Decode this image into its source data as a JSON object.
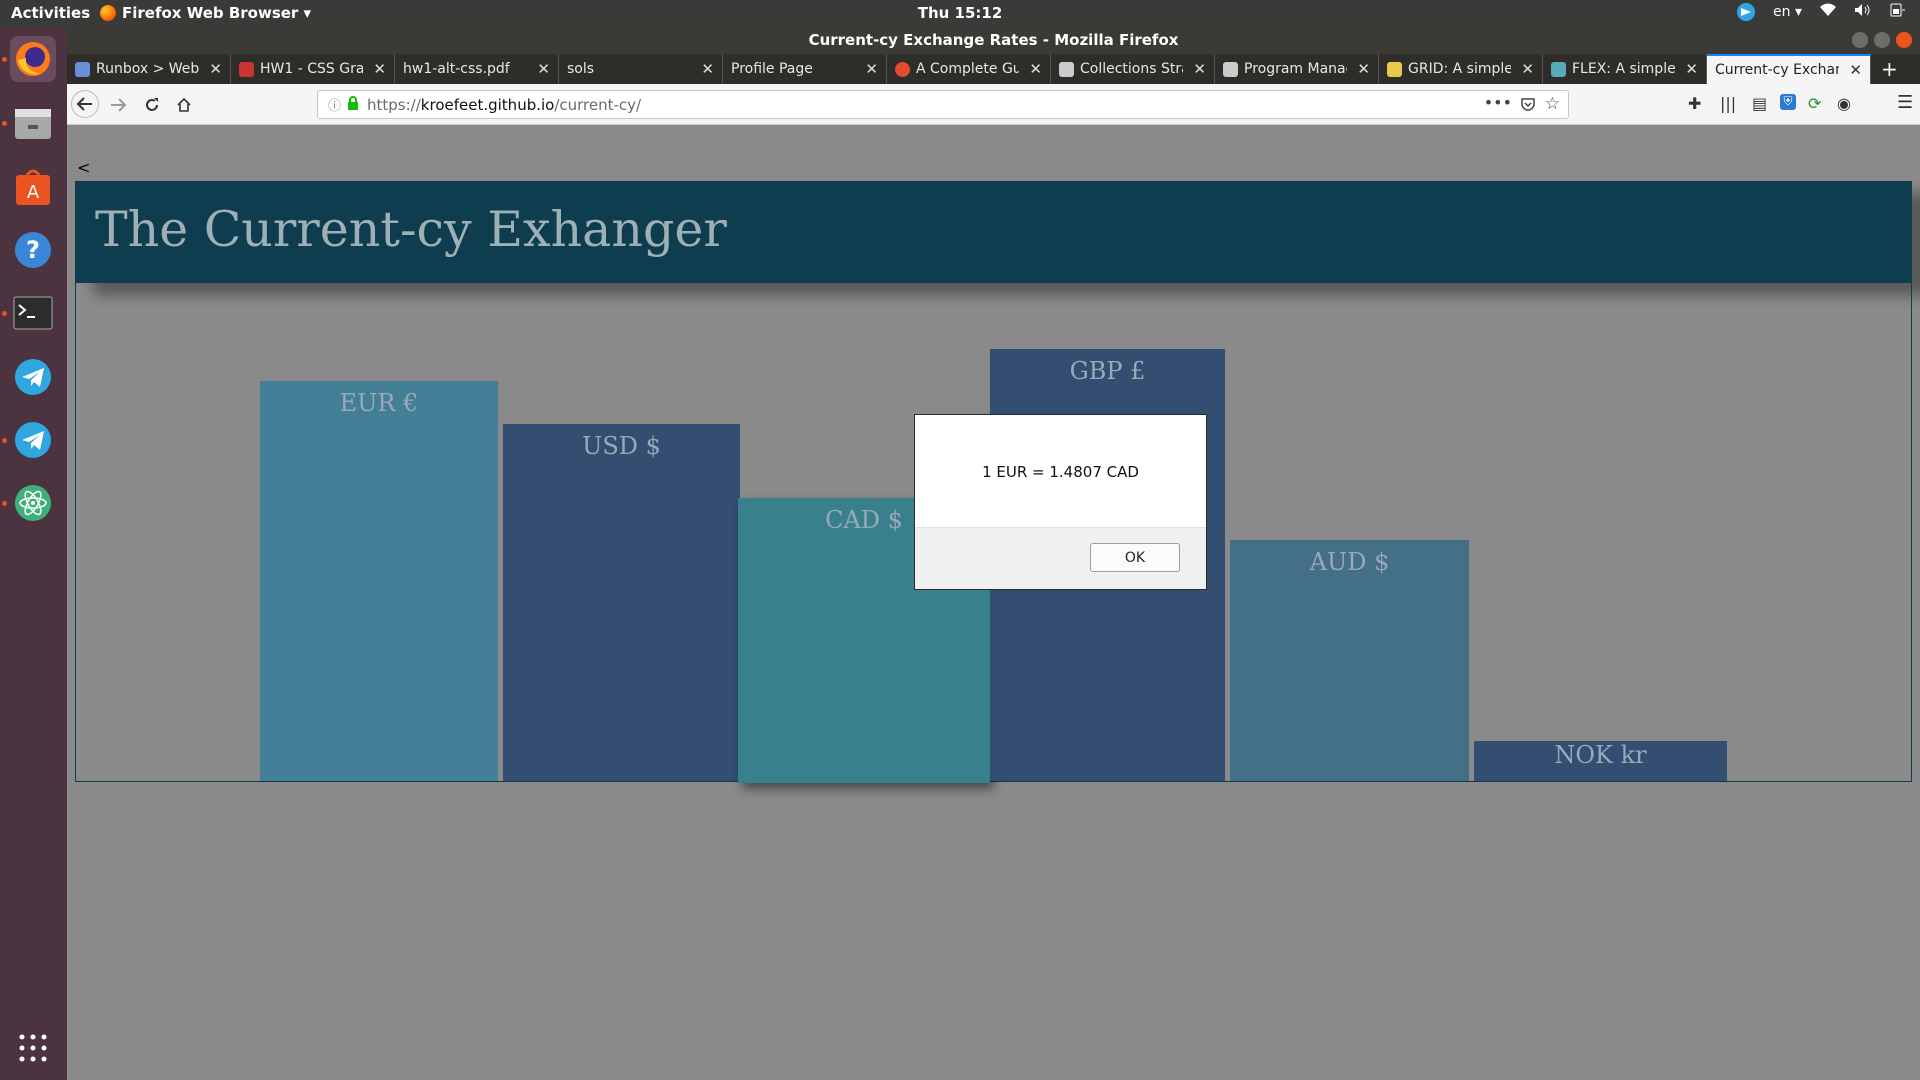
{
  "topbar": {
    "activities": "Activities",
    "app_name": "Firefox Web Browser ▾",
    "clock": "Thu 15:12",
    "lang": "en ▾"
  },
  "window": {
    "title": "Current-cy Exchange Rates - Mozilla Firefox"
  },
  "tabs": [
    {
      "label": "Runbox > Webmail",
      "icon_color": "#6a8fd8"
    },
    {
      "label": "HW1 - CSS Graphing",
      "icon_color": "#c33"
    },
    {
      "label": "hw1-alt-css.pdf",
      "icon_color": "#2e2d2a"
    },
    {
      "label": "sols",
      "icon_color": "#2e2d2a"
    },
    {
      "label": "Profile Page",
      "icon_color": "#2e2d2a"
    },
    {
      "label": "A Complete Guide",
      "icon_color": "#e34b2c"
    },
    {
      "label": "Collections Strategy",
      "icon_color": "#ccc"
    },
    {
      "label": "Program Manager",
      "icon_color": "#ccc"
    },
    {
      "label": "GRID: A simple",
      "icon_color": "#e8c94a"
    },
    {
      "label": "FLEX: A simple",
      "icon_color": "#5ab"
    },
    {
      "label": "Current-cy Exchange",
      "icon_color": "#f5f5f5"
    }
  ],
  "url": {
    "scheme": "https://",
    "host": "kroefeet.github.io",
    "path": "/current-cy/"
  },
  "page": {
    "back_link": "<",
    "title": "The Current-cy Exhanger",
    "bars": [
      {
        "label": "EUR €",
        "color": "#437f96"
      },
      {
        "label": "USD $",
        "color": "#344e72"
      },
      {
        "label": "CAD $",
        "color": "#38808b"
      },
      {
        "label": "GBP £",
        "color": "#344e72"
      },
      {
        "label": "AUD $",
        "color": "#437086"
      },
      {
        "label": "NOK kr",
        "color": "#344e72"
      }
    ]
  },
  "dialog": {
    "message": "1 EUR = 1.4807 CAD",
    "ok_label": "OK"
  }
}
